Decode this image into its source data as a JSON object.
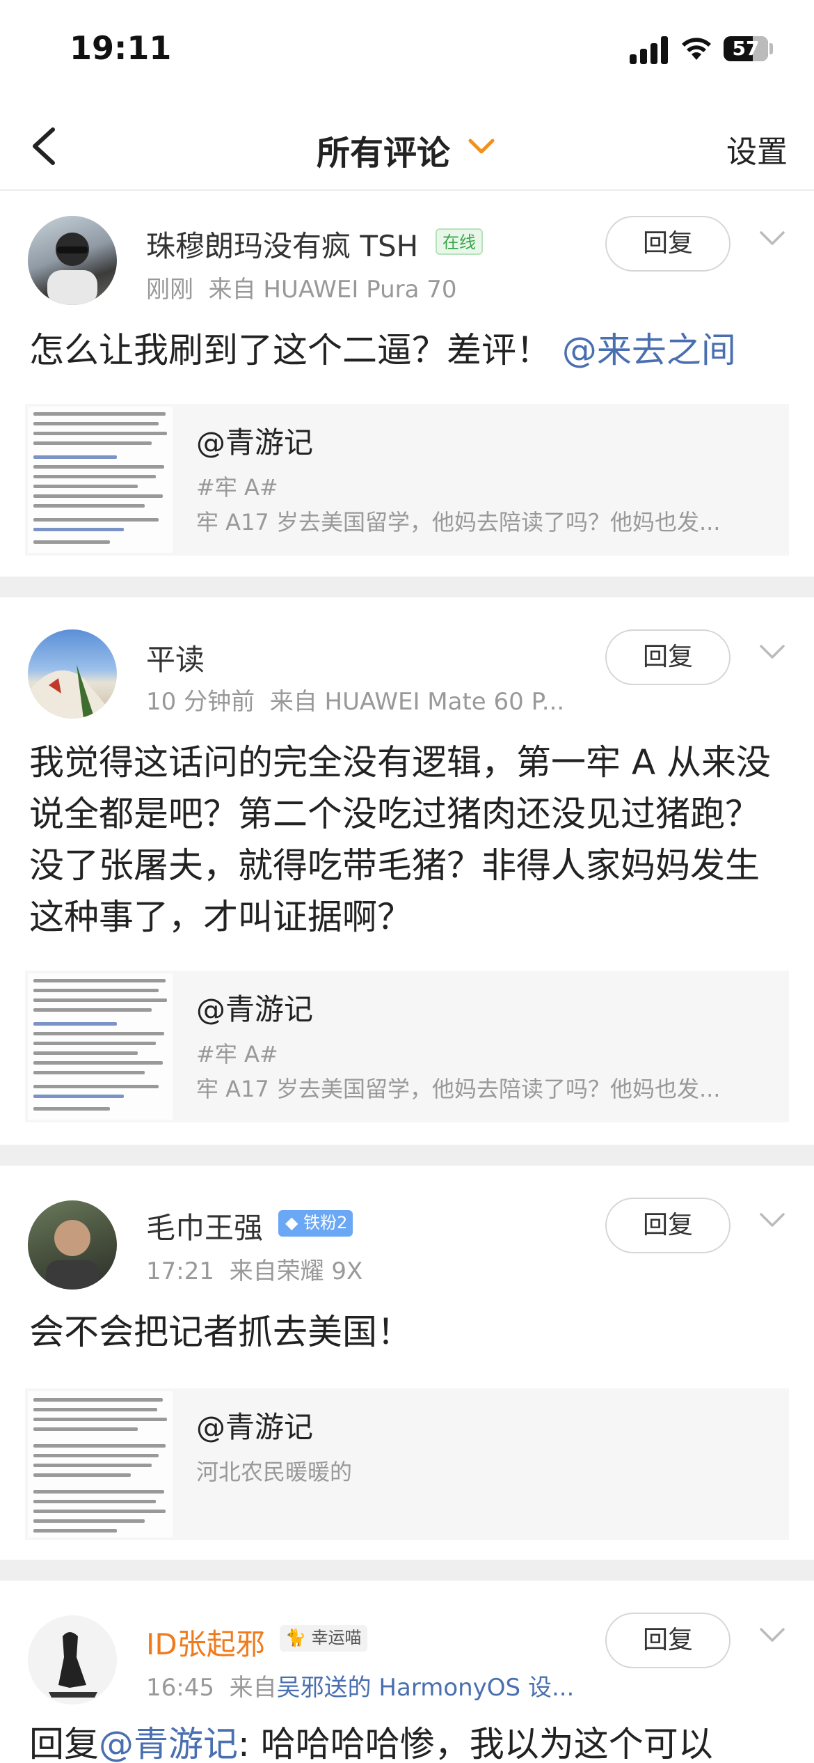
{
  "status_bar": {
    "time": "19:11",
    "battery": "57"
  },
  "nav": {
    "title": "所有评论",
    "settings": "设置"
  },
  "comments": [
    {
      "user": "珠穆朗玛没有疯 TSH",
      "badge": "在线",
      "time": "刚刚",
      "source": "来自 HUAWEI Pura 70",
      "reply": "回复",
      "text": "怎么让我刷到了这个二逼？差评！",
      "mention": "@来去之间",
      "quote": {
        "author": "@青游记",
        "tag": "#牢 A#",
        "text": "牢 A17 岁去美国留学，他妈去陪读了吗？他妈也发..."
      }
    },
    {
      "user": "平读",
      "time": "10 分钟前",
      "source": "来自 HUAWEI Mate 60 P...",
      "reply": "回复",
      "text": "我觉得这话问的完全没有逻辑，第一牢 A 从来没说全都是吧？第二个没吃过猪肉还没见过猪跑？没了张屠夫，就得吃带毛猪？非得人家妈妈发生这种事了，才叫证据啊？",
      "quote": {
        "author": "@青游记",
        "tag": "#牢 A#",
        "text": "牢 A17 岁去美国留学，他妈去陪读了吗？他妈也发..."
      }
    },
    {
      "user": "毛巾王强",
      "badge": "铁粉2",
      "time": "17:21",
      "source": "来自荣耀 9X",
      "reply": "回复",
      "text": "会不会把记者抓去美国！",
      "quote": {
        "author": "@青游记",
        "text": "河北农民暖暖的"
      }
    },
    {
      "user": "ID张起邪",
      "badge": "幸运喵",
      "time": "16:45",
      "source_prefix": "来自",
      "source": "吴邪送的 HarmonyOS 设...",
      "reply": "回复",
      "text_prefix": "回复",
      "mention": "@青游记",
      "text": ": 哈哈哈哈惨，我以为这个可以"
    }
  ]
}
